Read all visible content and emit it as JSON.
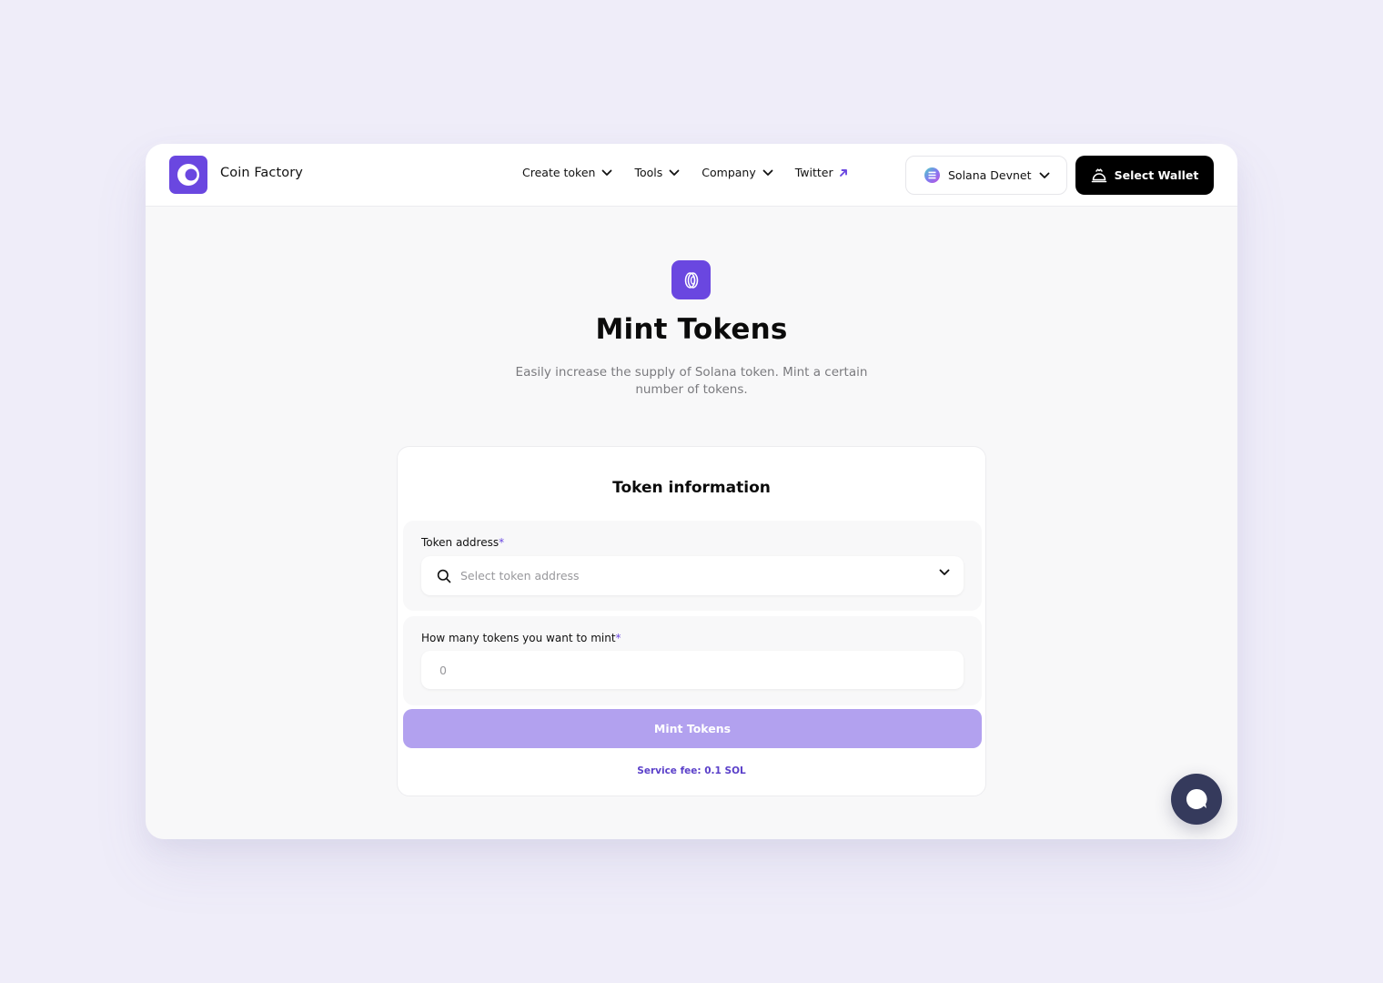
{
  "app": {
    "brand_name": "Coin Factory",
    "accent_color": "#6a47e0"
  },
  "nav": {
    "items": [
      {
        "label": "Create token",
        "icon": "chevron-down-icon"
      },
      {
        "label": "Tools",
        "icon": "chevron-down-icon"
      },
      {
        "label": "Company",
        "icon": "chevron-down-icon"
      },
      {
        "label": "Twitter",
        "icon": "external-arrow-icon"
      }
    ],
    "network_label": "Solana Devnet",
    "wallet_label": "Select Wallet"
  },
  "hero": {
    "icon": "coin-icon",
    "title": "Mint Tokens",
    "subtitle": "Easily increase the supply of Solana token. Mint a certain number of tokens."
  },
  "form": {
    "title": "Token information",
    "token_address": {
      "label": "Token address",
      "required_mark": "*",
      "placeholder": "Select token address",
      "value": ""
    },
    "mint_amount": {
      "label": "How many tokens you want to mint",
      "required_mark": "*",
      "placeholder": "0",
      "value": ""
    },
    "submit_label": "Mint Tokens",
    "service_fee": "Service fee: 0.1 SOL"
  },
  "chat": {
    "icon": "chat-bubble-icon"
  }
}
